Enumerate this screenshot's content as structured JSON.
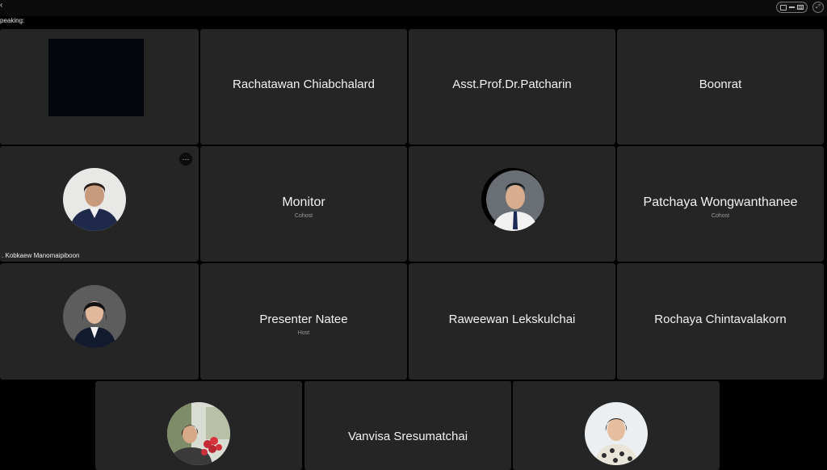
{
  "titlebar": {
    "back_icon": "chevron-left-icon",
    "window_controls": [
      "restore-window-icon",
      "minimize-icon",
      "grid-layout-icon",
      "fullscreen-icon"
    ]
  },
  "speaking_label": "peaking:",
  "participants": {
    "rachatawan": {
      "name": "Rachatawan Chiabchalard"
    },
    "patcharin": {
      "name": "Asst.Prof.Dr.Patcharin"
    },
    "boonrat": {
      "name": "Boonrat"
    },
    "kobkaew": {
      "name": ". Kobkaew Manomaipiboon",
      "more_label": "···"
    },
    "monitor": {
      "name": "Monitor",
      "role": "Cohost"
    },
    "patchaya": {
      "name": "Patchaya Wongwanthanee",
      "role": "Cohost"
    },
    "natee": {
      "name": "Presenter Natee",
      "role": "Host"
    },
    "raweewan": {
      "name": "Raweewan Lekskulchai"
    },
    "rochaya": {
      "name": "Rochaya Chintavalakorn"
    },
    "vanvisa": {
      "name": "Vanvisa Sresumatchai"
    }
  }
}
